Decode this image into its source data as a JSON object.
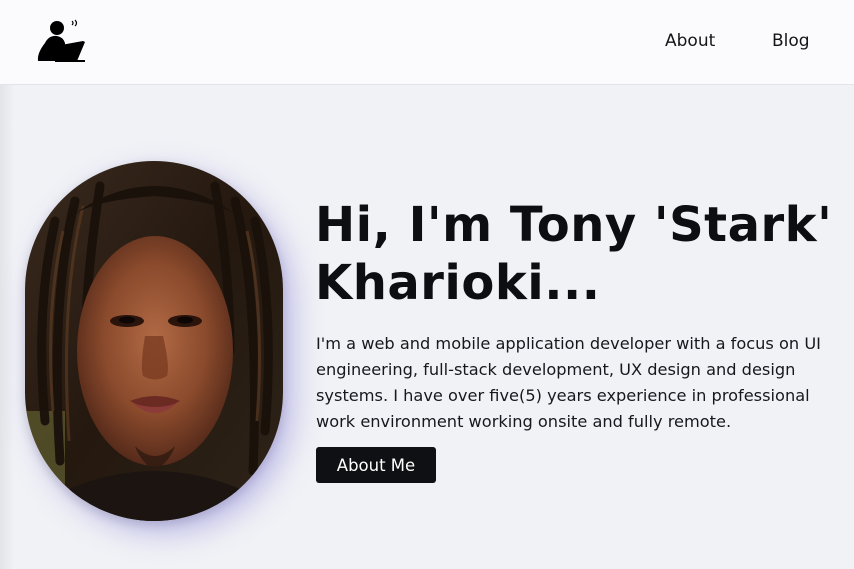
{
  "nav": {
    "logo_icon": "person-at-laptop-icon",
    "items": [
      {
        "label": "About"
      },
      {
        "label": "Blog"
      }
    ]
  },
  "hero": {
    "headline_line1": "Hi, I'm Tony 'Stark'",
    "headline_line2": "Kharioki...",
    "bio": "I'm a web and mobile application developer with a focus on UI engineering, full-stack development, UX design and design systems. I have over five(5) years experience in professional work environment working onsite and fully remote.",
    "cta_label": "About Me",
    "portrait_icon": "portrait-photo"
  },
  "colors": {
    "background": "#f1f2f6",
    "header_bg": "#fbfbfd",
    "text": "#0f1014",
    "button_bg": "#0f1014",
    "button_text": "#ffffff",
    "avatar_shadow": "#5a50c8"
  }
}
